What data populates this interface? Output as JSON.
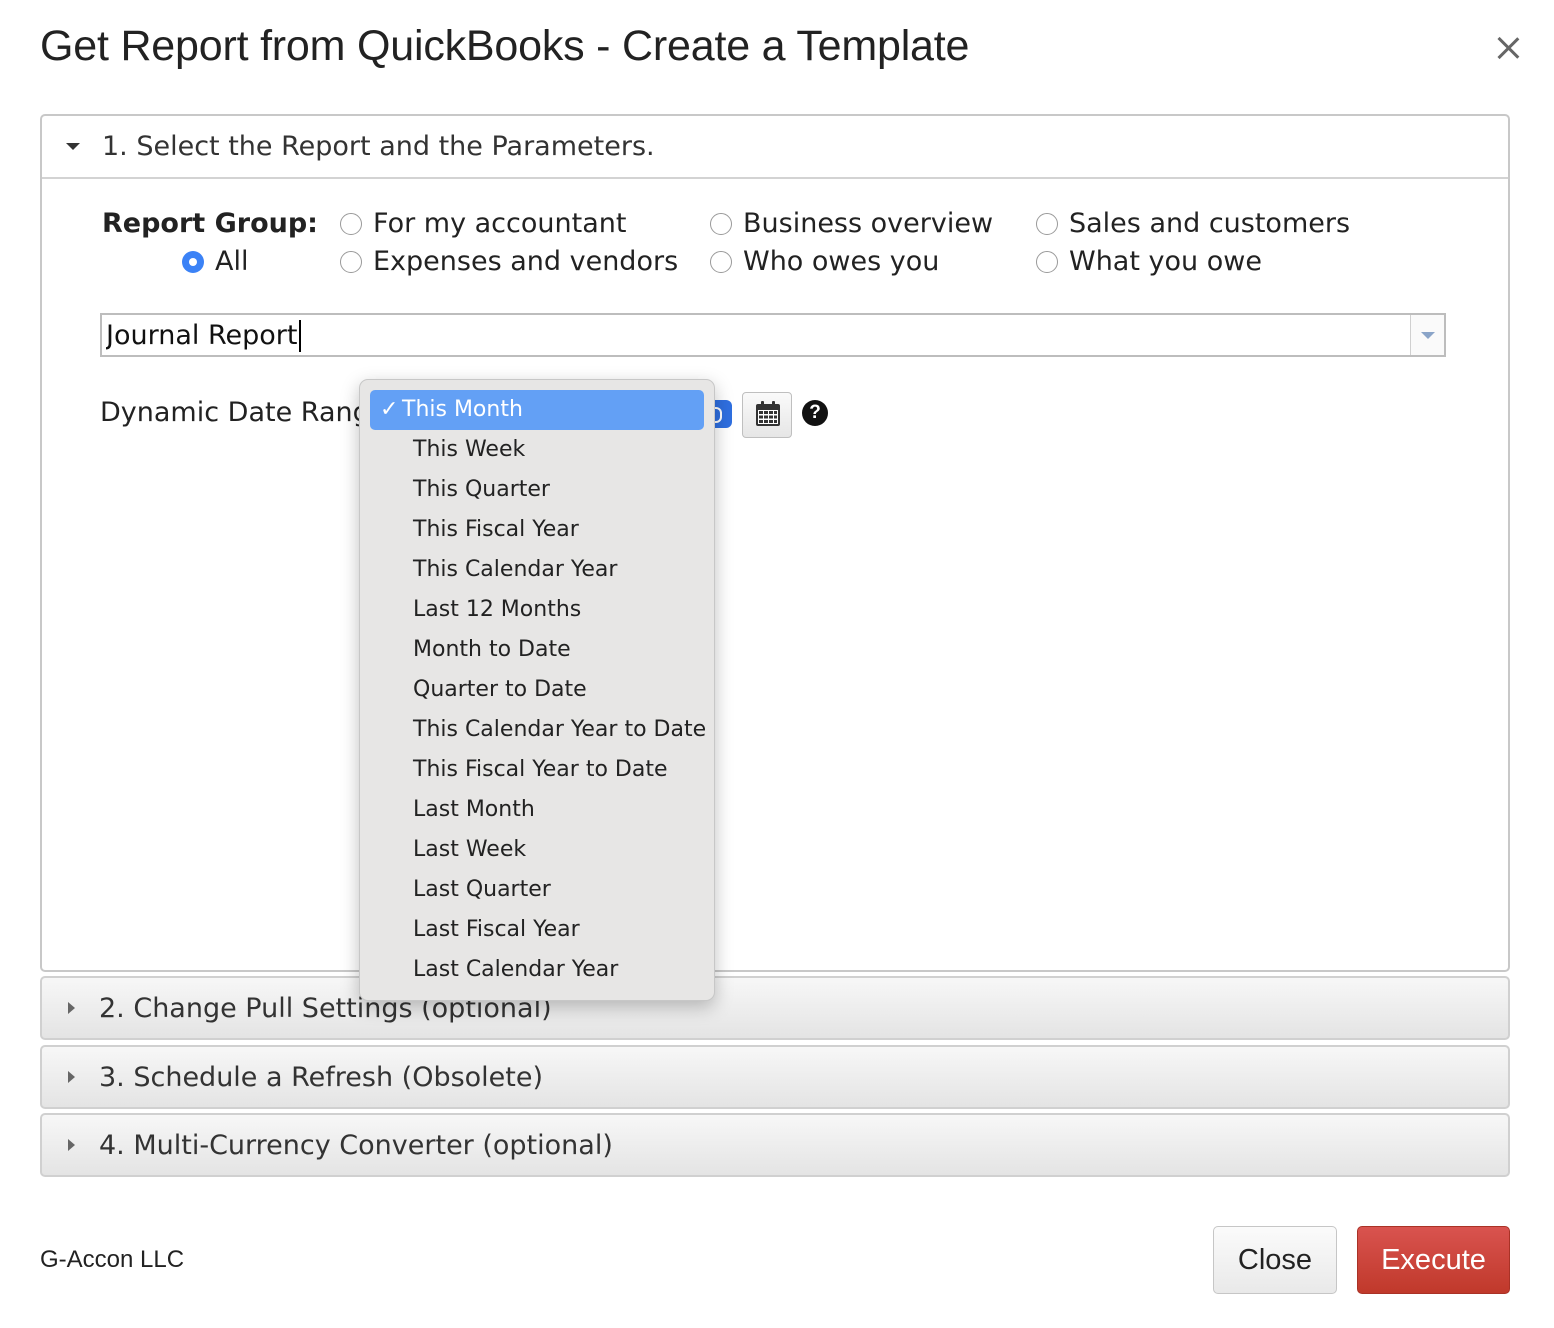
{
  "dialog": {
    "title": "Get Report from QuickBooks - Create a Template"
  },
  "section1": {
    "title": "1. Select the Report and the Parameters.",
    "report_group_label": "Report Group:",
    "radios": [
      {
        "label": "All",
        "checked": true
      },
      {
        "label": "For my accountant",
        "checked": false
      },
      {
        "label": "Expenses and vendors",
        "checked": false
      },
      {
        "label": "Business overview",
        "checked": false
      },
      {
        "label": "Who owes you",
        "checked": false
      },
      {
        "label": "Sales and customers",
        "checked": false
      },
      {
        "label": "What you owe",
        "checked": false
      }
    ],
    "report_combo_value": "Journal Report",
    "dynamic_date_label": "Dynamic Date Range:",
    "help_glyph": "?"
  },
  "date_dropdown": {
    "check_glyph": "✓",
    "selected_index": 0,
    "options": [
      "This Month",
      "This Week",
      "This Quarter",
      "This Fiscal Year",
      "This Calendar Year",
      "Last 12 Months",
      "Month to Date",
      "Quarter to Date",
      "This Calendar Year to Date",
      "This Fiscal Year to Date",
      "Last Month",
      "Last Week",
      "Last Quarter",
      "Last Fiscal Year",
      "Last Calendar Year"
    ]
  },
  "collapsed_sections": [
    {
      "title": "2. Change Pull Settings (optional)"
    },
    {
      "title": "3. Schedule a Refresh (Obsolete)"
    },
    {
      "title": "4. Multi-Currency Converter (optional)"
    }
  ],
  "footer": {
    "brand": "G-Accon LLC",
    "close_label": "Close",
    "execute_label": "Execute"
  },
  "colors": {
    "execute": "#c9302c",
    "radio_checked": "#3b82f6",
    "dropdown_selected": "#63a0f5"
  }
}
